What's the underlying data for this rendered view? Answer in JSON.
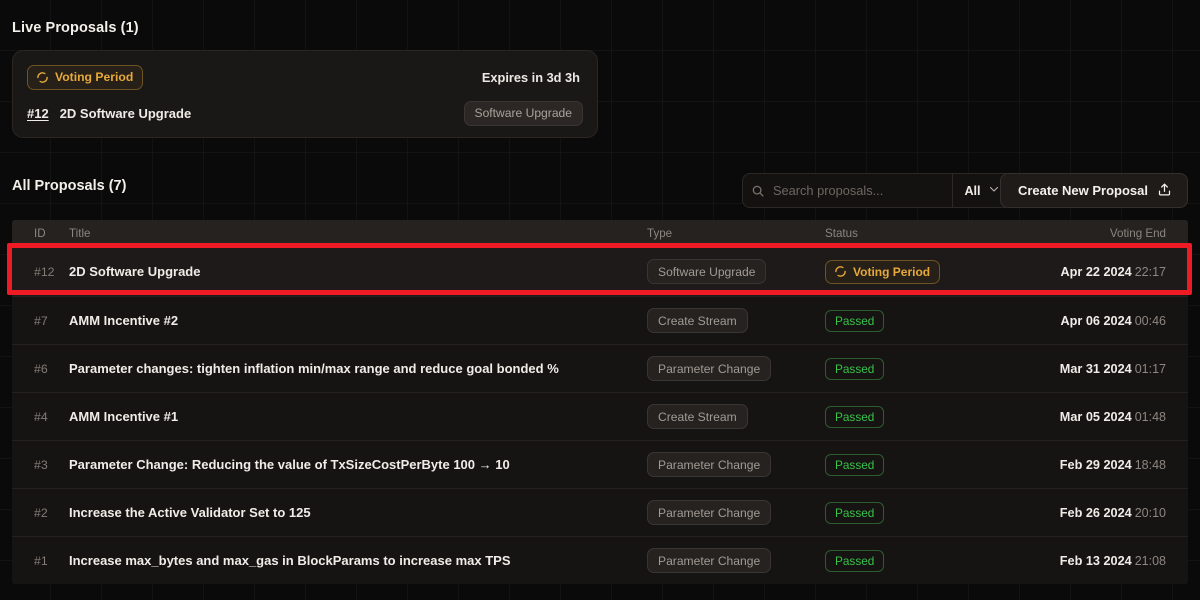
{
  "live": {
    "heading": "Live Proposals (1)",
    "card": {
      "status_badge": "Voting Period",
      "status_icon": "spinner-icon",
      "expires": "Expires in 3d 3h",
      "id": "#12",
      "title": "2D Software Upgrade",
      "type": "Software Upgrade"
    }
  },
  "toolbar": {
    "heading": "All Proposals (7)",
    "search_placeholder": "Search proposals...",
    "search_value": "",
    "search_icon": "search-icon",
    "filter_value": "All",
    "filter_icon": "chevron-down-icon",
    "create_label": "Create New Proposal",
    "create_icon": "upload-icon"
  },
  "table": {
    "columns": [
      "ID",
      "Title",
      "Type",
      "Status",
      "Voting End"
    ],
    "rows": [
      {
        "id": "#12",
        "title": "2D Software Upgrade",
        "type": "Software Upgrade",
        "status": "Voting Period",
        "status_kind": "voting",
        "date": "Apr 22 2024",
        "time": "22:17",
        "highlighted": true
      },
      {
        "id": "#7",
        "title": "AMM Incentive #2",
        "type": "Create Stream",
        "status": "Passed",
        "status_kind": "passed",
        "date": "Apr 06 2024",
        "time": "00:46",
        "highlighted": false
      },
      {
        "id": "#6",
        "title": "Parameter changes: tighten inflation min/max range and reduce goal bonded %",
        "type": "Parameter Change",
        "status": "Passed",
        "status_kind": "passed",
        "date": "Mar 31 2024",
        "time": "01:17",
        "highlighted": false
      },
      {
        "id": "#4",
        "title": "AMM Incentive #1",
        "type": "Create Stream",
        "status": "Passed",
        "status_kind": "passed",
        "date": "Mar 05 2024",
        "time": "01:48",
        "highlighted": false
      },
      {
        "id": "#3",
        "title": "Parameter Change: Reducing the value of TxSizeCostPerByte 100 → 10",
        "type": "Parameter Change",
        "status": "Passed",
        "status_kind": "passed",
        "date": "Feb 29 2024",
        "time": "18:48",
        "highlighted": false
      },
      {
        "id": "#2",
        "title": "Increase the Active Validator Set to 125",
        "type": "Parameter Change",
        "status": "Passed",
        "status_kind": "passed",
        "date": "Feb 26 2024",
        "time": "20:10",
        "highlighted": false
      },
      {
        "id": "#1",
        "title": "Increase max_bytes and max_gas in BlockParams to increase max TPS",
        "type": "Parameter Change",
        "status": "Passed",
        "status_kind": "passed",
        "date": "Feb 13 2024",
        "time": "21:08",
        "highlighted": false
      }
    ]
  },
  "annotation": {
    "highlight_color": "#ef1b24",
    "target_row_id": "#12"
  },
  "colors": {
    "page_bg": "#0a0a0a",
    "panel_bg": "#161413",
    "accent_voting": "#e6a93a",
    "accent_passed": "#39c14a",
    "text_primary": "#f0ece7",
    "text_muted": "#8c8580"
  }
}
